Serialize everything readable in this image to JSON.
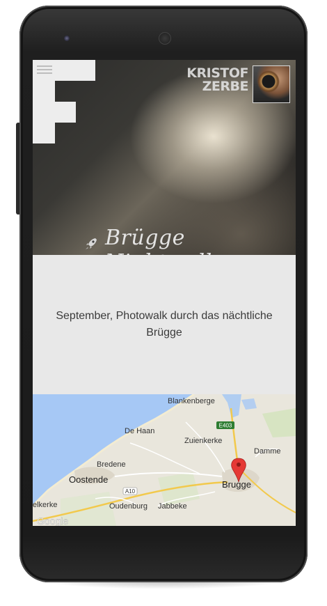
{
  "header": {
    "menu_icon": "hamburger-menu-icon",
    "brand_line1": "KRISTOF",
    "brand_line2": "ZERBE"
  },
  "hero": {
    "title": "Brügge Nightwalk",
    "title_icon": "rocket-icon"
  },
  "content": {
    "description": "September, Photowalk durch das nächtliche Brügge"
  },
  "map": {
    "places": {
      "blankenberge": "Blankenberge",
      "de_haan": "De Haan",
      "zuienkerke": "Zuienkerke",
      "damme": "Damme",
      "bredene": "Bredene",
      "oostende": "Oostende",
      "brugge": "Brugge",
      "middelkerke": "elkerke",
      "oudenburg": "Oudenburg",
      "jabbeke": "Jabbeke"
    },
    "roads": {
      "e403": "E403",
      "a10": "A10"
    },
    "watermark": "Google",
    "marker_icon": "map-pin-icon"
  },
  "colors": {
    "sea": "#a6c8f5",
    "land": "#e9e6dc",
    "marker": "#e53935"
  }
}
